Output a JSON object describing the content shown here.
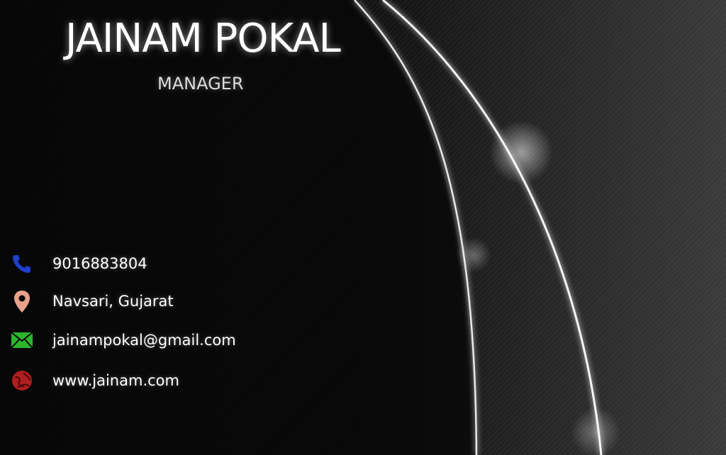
{
  "card": {
    "name": "JAINAM POKAL",
    "title": "MANAGER"
  },
  "contacts": [
    {
      "icon": "phone-icon",
      "text": "9016883804",
      "color": "#1f3fcf"
    },
    {
      "icon": "location-pin-icon",
      "text": "Navsari, Gujarat",
      "color": "#e8a28c"
    },
    {
      "icon": "mail-icon",
      "text": "jainampokal@gmail.com",
      "color": "#2db52d"
    },
    {
      "icon": "globe-icon",
      "text": "www.jainam.com",
      "color": "#b01e1e"
    }
  ]
}
